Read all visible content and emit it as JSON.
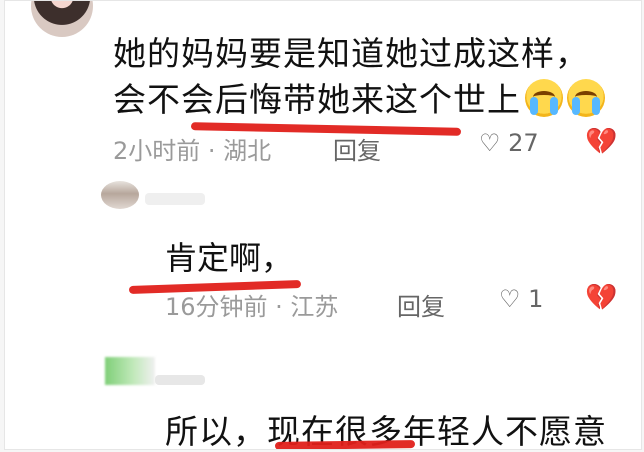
{
  "comments": {
    "main": {
      "text_line1": "她的妈妈要是知道她过成这样，",
      "text_line2": "会不会后悔带她来这个世上",
      "meta": "2小时前 · 湖北",
      "reply_label": "回复",
      "likes": "27",
      "emojis": [
        "crying-face-icon",
        "crying-face-icon"
      ]
    },
    "reply1": {
      "text": "肯定啊，",
      "meta": "16分钟前 · 江苏",
      "reply_label": "回复",
      "likes": "1"
    },
    "reply2": {
      "text": "所以，现在很多年轻人不愿意"
    }
  },
  "icons": {
    "like": "heart-outline-icon",
    "dislike": "broken-heart-icon"
  },
  "colors": {
    "annotation_underline": "#e0201a"
  }
}
